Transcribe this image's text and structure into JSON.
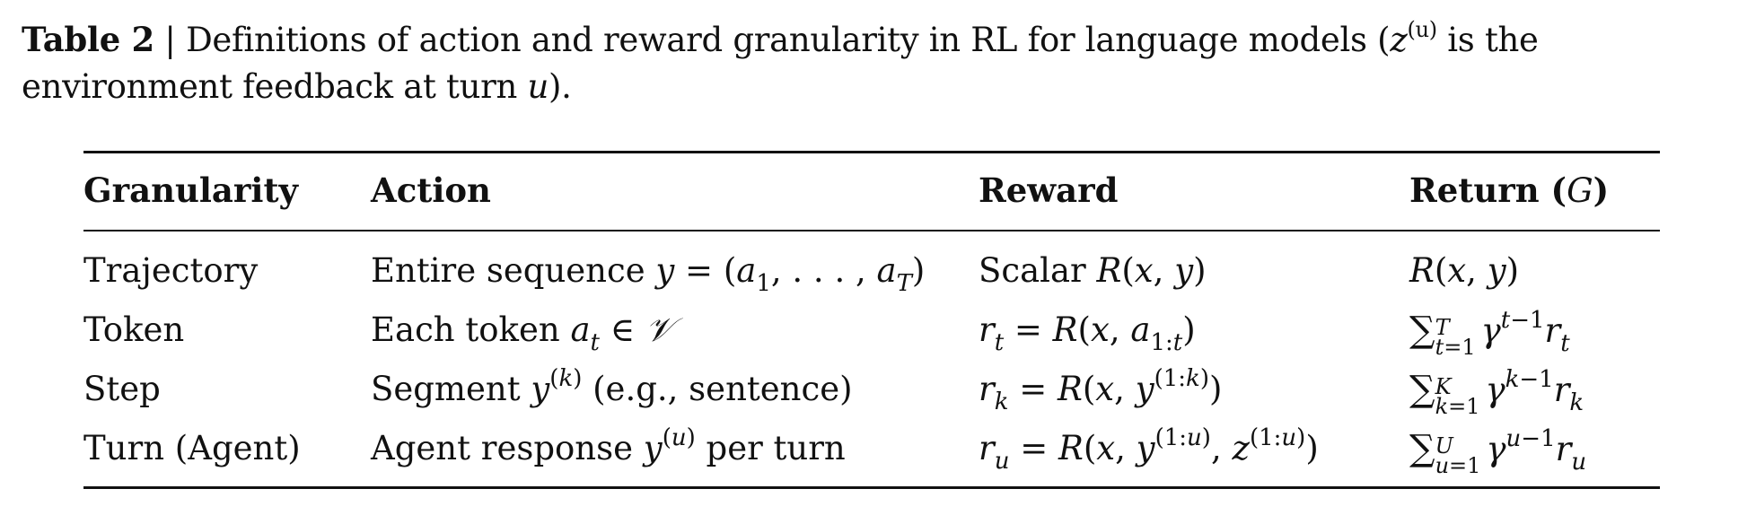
{
  "caption": {
    "label": "Table 2",
    "separator": " | ",
    "text_before_math": "Definitions of action and reward granularity in RL for language models (",
    "math_z": "z",
    "math_sup": "(u)",
    "text_after_math": " is the environment feedback at turn ",
    "math_u": "u",
    "text_end": ")."
  },
  "table": {
    "headers": {
      "granularity": "Granularity",
      "action": "Action",
      "reward": "Reward",
      "return_text": "Return (",
      "return_symbol": "G",
      "return_close": ")"
    },
    "rows": [
      {
        "granularity": "Trajectory",
        "action": "Entire sequence y = (a₁, . . . , a_T)",
        "reward": "Scalar R(x, y)",
        "return": "R(x, y)"
      },
      {
        "granularity": "Token",
        "action": "Each token a_t ∈ 𝒱",
        "reward": "r_t = R(x, a_{1:t})",
        "return": "∑_{t=1}^{T} γ^{t−1} r_t"
      },
      {
        "granularity": "Step",
        "action": "Segment y^{(k)} (e.g., sentence)",
        "reward": "r_k = R(x, y^{(1:k)})",
        "return": "∑_{k=1}^{K} γ^{k−1} r_k"
      },
      {
        "granularity": "Turn (Agent)",
        "action": "Agent response y^{(u)} per turn",
        "reward": "r_u = R(x, y^{(1:u)}, z^{(1:u)})",
        "return": "∑_{u=1}^{U} γ^{u−1} r_u"
      }
    ]
  }
}
